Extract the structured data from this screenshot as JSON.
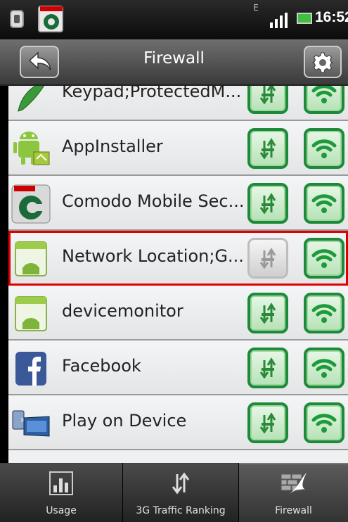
{
  "statusbar": {
    "time": "16:52",
    "network_type": "E"
  },
  "header": {
    "title": "Firewall"
  },
  "apps": [
    {
      "name": "Keypad;ProtectedM...",
      "icon": "leaf-icon",
      "data_enabled": true,
      "wifi_enabled": true
    },
    {
      "name": "AppInstaller",
      "icon": "android-installer-icon",
      "data_enabled": true,
      "wifi_enabled": true
    },
    {
      "name": "Comodo Mobile Sec...",
      "icon": "comodo-icon",
      "data_enabled": true,
      "wifi_enabled": true
    },
    {
      "name": "Network Location;G...",
      "icon": "android-app-icon",
      "data_enabled": false,
      "wifi_enabled": true,
      "selected": true
    },
    {
      "name": "devicemonitor",
      "icon": "android-app-icon",
      "data_enabled": true,
      "wifi_enabled": true
    },
    {
      "name": "Facebook",
      "icon": "facebook-icon",
      "data_enabled": true,
      "wifi_enabled": true
    },
    {
      "name": "Play on Device",
      "icon": "play-on-device-icon",
      "data_enabled": true,
      "wifi_enabled": true
    }
  ],
  "tabs": [
    {
      "label": "Usage",
      "icon": "bar-chart-icon",
      "active": false
    },
    {
      "label": "3G Traffic Ranking",
      "icon": "data-transfer-icon",
      "active": false
    },
    {
      "label": "Firewall",
      "icon": "firewall-icon",
      "active": true
    }
  ],
  "colors": {
    "enabled_green": "#1d8a3a",
    "selection_red": "#e00000"
  }
}
